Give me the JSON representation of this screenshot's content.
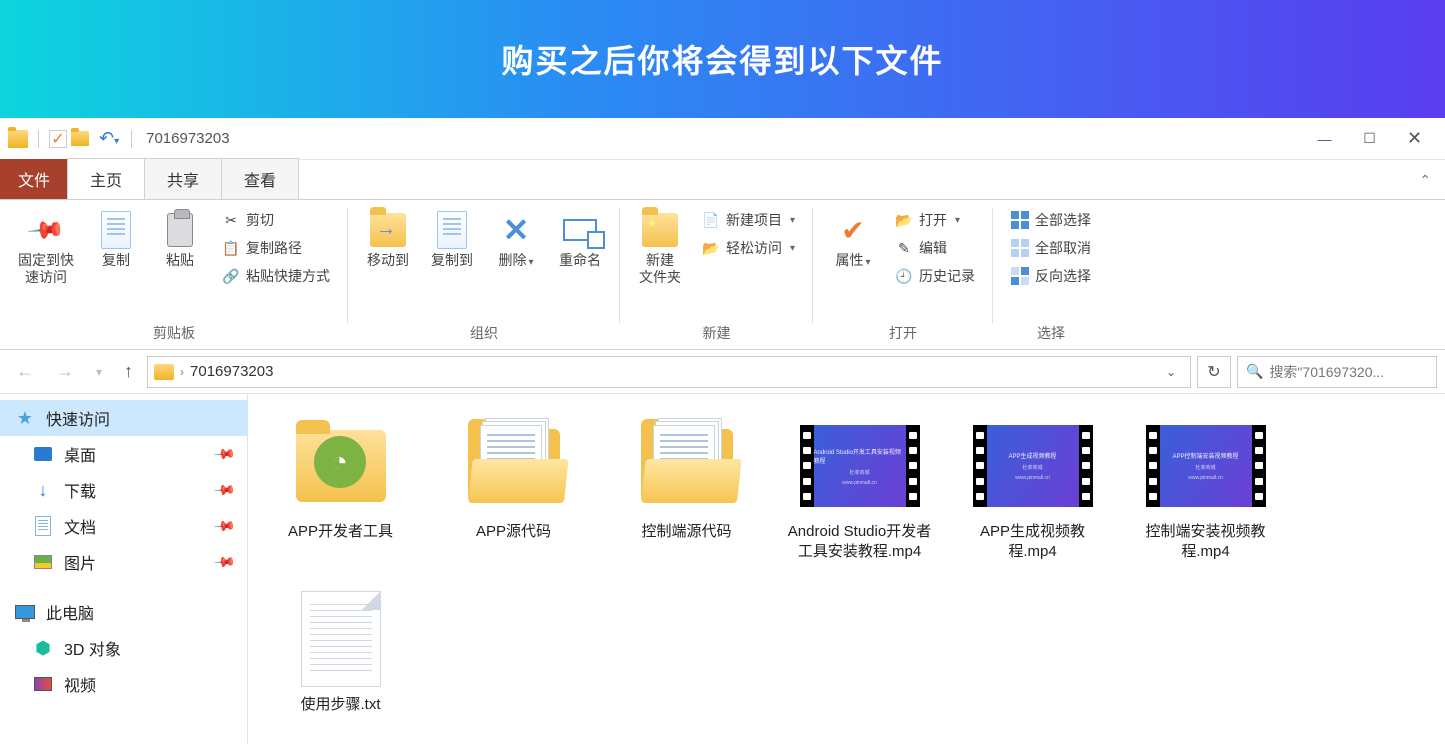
{
  "banner": {
    "text": "购买之后你将会得到以下文件"
  },
  "titlebar": {
    "title": "7016973203"
  },
  "tabs": {
    "file": "文件",
    "home": "主页",
    "share": "共享",
    "view": "查看"
  },
  "ribbon": {
    "clipboard": {
      "label": "剪贴板",
      "pin": "固定到快\n速访问",
      "copy": "复制",
      "paste": "粘贴",
      "cut": "剪切",
      "copypath": "复制路径",
      "pasteshortcut": "粘贴快捷方式"
    },
    "organize": {
      "label": "组织",
      "moveto": "移动到",
      "copyto": "复制到",
      "delete": "删除",
      "rename": "重命名"
    },
    "new": {
      "label": "新建",
      "newfolder": "新建\n文件夹",
      "newitem": "新建项目",
      "easyaccess": "轻松访问"
    },
    "open": {
      "label": "打开",
      "properties": "属性",
      "open": "打开",
      "edit": "编辑",
      "history": "历史记录"
    },
    "select": {
      "label": "选择",
      "selectall": "全部选择",
      "selectnone": "全部取消",
      "invert": "反向选择"
    }
  },
  "nav": {
    "path": "7016973203",
    "search_placeholder": "搜索\"701697320..."
  },
  "sidebar": {
    "quickaccess": "快速访问",
    "desktop": "桌面",
    "downloads": "下载",
    "documents": "文档",
    "pictures": "图片",
    "thispc": "此电脑",
    "objects3d": "3D 对象",
    "videos": "视频"
  },
  "files": [
    {
      "name": "APP开发者工具",
      "type": "folder-android"
    },
    {
      "name": "APP源代码",
      "type": "folder-docs"
    },
    {
      "name": "控制端源代码",
      "type": "folder-docs"
    },
    {
      "name": "Android Studio开发者工具安装教程.mp4",
      "type": "video"
    },
    {
      "name": "APP生成视频教程.mp4",
      "type": "video"
    },
    {
      "name": "控制端安装视频教程.mp4",
      "type": "video"
    },
    {
      "name": "使用步骤.txt",
      "type": "txt"
    }
  ]
}
